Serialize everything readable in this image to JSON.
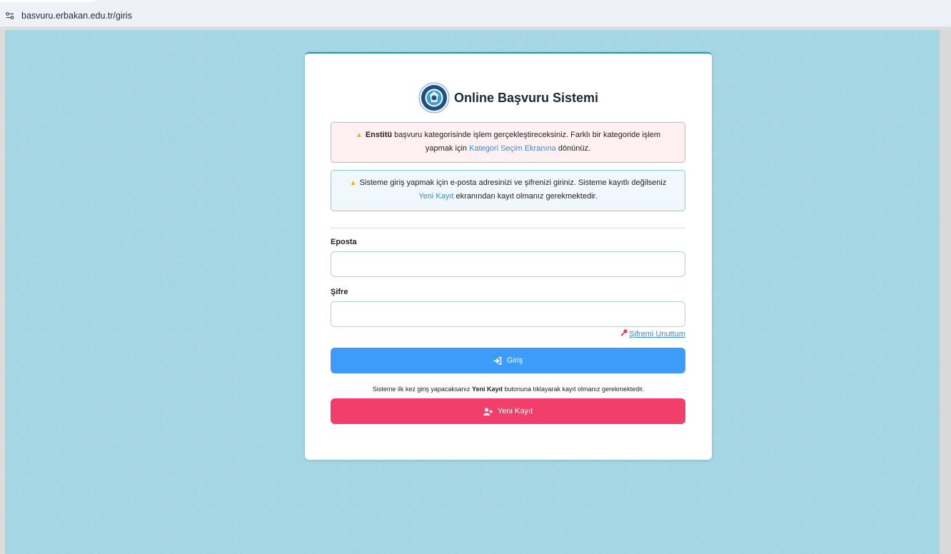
{
  "browser": {
    "url": "basvuru.erbakan.edu.tr/giris",
    "site_icon": "site-settings-icon"
  },
  "card": {
    "title": "Online Başvuru Sistemi",
    "logo": "university-logo"
  },
  "alerts": {
    "category": {
      "icon": "warning-icon",
      "bold": "Enstitü",
      "text_before_link": " başvuru kategorisinde işlem gerçekleştireceksiniz. Farklı bir kategoride işlem yapmak için ",
      "link": "Kategori Seçim Ekranına",
      "text_after_link": " dönünüz."
    },
    "login_info": {
      "icon": "warning-icon",
      "text_before_link": "Sisteme giriş yapmak için e-posta adresinizi ve şifrenizi giriniz. Sisteme kayıtlı değilseniz ",
      "link": "Yeni Kayıt",
      "text_after_link": " ekranından kayıt olmanız gerekmektedir."
    }
  },
  "form": {
    "email_label": "Eposta",
    "email_value": "",
    "password_label": "Şifre",
    "password_value": "",
    "forgot_label": "Şifremi Unuttum",
    "login_label": "Giriş",
    "note_before": "Sisteme ilk kez giriş yapacaksanız ",
    "note_bold": "Yeni Kayıt",
    "note_after": " butonuna tıklayarak kayıt olmanız gerekmektedir.",
    "register_label": "Yeni Kayıt"
  },
  "colors": {
    "background": "#a5d6e3",
    "login_button": "#3d9bfa",
    "register_button": "#f23e6b",
    "link": "#3b8bd6",
    "card_accent": "#1f9bbd"
  }
}
